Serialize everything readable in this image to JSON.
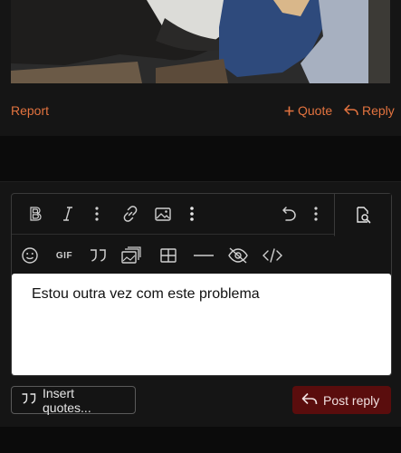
{
  "post": {
    "image_alt": "",
    "actions": {
      "report_label": "Report",
      "quote_label": "Quote",
      "reply_label": "Reply"
    }
  },
  "editor": {
    "toolbar_row1": [
      "bold-icon",
      "italic-icon",
      "more-text-icon",
      "link-icon",
      "image-icon",
      "more-insert-icon",
      "undo-icon",
      "more-options-icon",
      "preview-icon"
    ],
    "toolbar_row2": [
      "smile-icon",
      "gif-icon",
      "quote-icon",
      "media-icon",
      "table-icon",
      "horizontal-rule-icon",
      "spoiler-icon",
      "code-icon"
    ],
    "gif_label": "GIF",
    "content": "Estou outra vez com este problema"
  },
  "buttons": {
    "insert_quotes_label": "Insert quotes...",
    "post_reply_label": "Post reply"
  },
  "colors": {
    "accent": "#e3733f",
    "post_reply_bg": "#5a0d0d",
    "page_bg": "#0b0b0b",
    "card_bg": "#151515"
  }
}
